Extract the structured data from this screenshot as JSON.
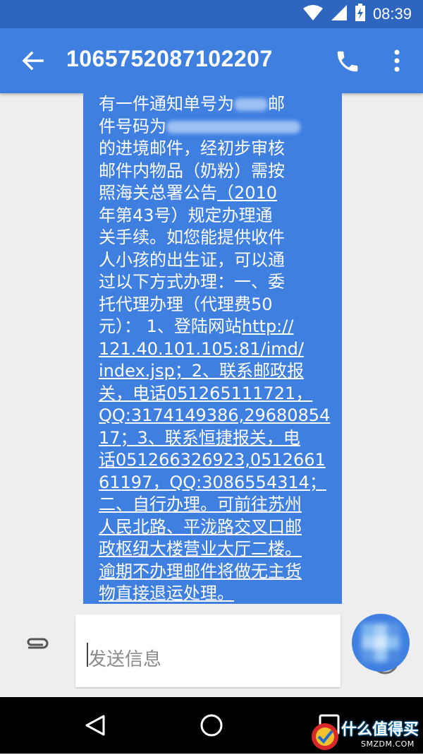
{
  "status_bar": {
    "time": "08:39",
    "icons": [
      "wifi-icon",
      "cellular-signal-icon",
      "battery-charging-icon"
    ]
  },
  "app_bar": {
    "title": "1065752087102207",
    "icons": [
      "back-arrow-icon",
      "phone-icon",
      "more-vert-icon"
    ]
  },
  "message": {
    "lines": [
      [
        {
          "t": "有一件通知单号为"
        },
        {
          "redacted": true
        },
        {
          "t": "邮"
        }
      ],
      [
        {
          "t": "件号码为"
        },
        {
          "redacted": true
        }
      ],
      [
        {
          "t": "的进境邮件，经初步审核"
        }
      ],
      [
        {
          "t": "邮件内物品（奶粉）需按"
        }
      ],
      [
        {
          "t": "照海关总署公告"
        },
        {
          "t": "（2010",
          "u": true
        }
      ],
      [
        {
          "t": "年第43号）规定办理通"
        }
      ],
      [
        {
          "t": "关手续。如您能提供收件"
        }
      ],
      [
        {
          "t": "人小孩的出生证，可以通"
        }
      ],
      [
        {
          "t": "过以下方式办理：一、委"
        }
      ],
      [
        {
          "t": "托代理办理（代理费50"
        }
      ],
      [
        {
          "t": "元）：  1、登陆网站"
        },
        {
          "t": "http://",
          "u": true
        }
      ],
      [
        {
          "t": "121.40.101.105:81/imd/",
          "u": true
        }
      ],
      [
        {
          "t": "index.jsp；2、联系邮政报",
          "u": true
        }
      ],
      [
        {
          "t": "关，电话051265111721，",
          "u": true
        }
      ],
      [
        {
          "t": "QQ:3174149386,29680854",
          "u": true
        }
      ],
      [
        {
          "t": "17；3、联系恒捷报关，电",
          "u": true
        }
      ],
      [
        {
          "t": "话051266326923,0512661",
          "u": true
        }
      ],
      [
        {
          "t": "61197，QQ:3086554314；",
          "u": true
        }
      ],
      [
        {
          "t": "二、自行办理。可前往苏州",
          "u": true
        }
      ],
      [
        {
          "t": "人民北路、平泷路交叉口邮",
          "u": true
        }
      ],
      [
        {
          "t": "政枢纽大楼营业大厅二楼。",
          "u": true
        }
      ],
      [
        {
          "t": "逾期不办理邮件将做无主货",
          "u": true
        }
      ],
      [
        {
          "t": "物直接退运处理。",
          "u": true
        }
      ]
    ]
  },
  "composer": {
    "placeholder": "发送信息",
    "icons": [
      "attachment-icon",
      "emoji-icon"
    ]
  },
  "nav_bar": {
    "icons": [
      "nav-back-icon",
      "nav-home-icon",
      "nav-recents-icon"
    ]
  },
  "watermark": {
    "text": "什么值得买",
    "sub": "SMZDM.COM"
  },
  "colors": {
    "status_bar": "#2e65bf",
    "app_bar": "#3f7fe0",
    "bubble": "#3f7fe0",
    "background": "#eeeeee",
    "nav_bar": "#000000"
  }
}
